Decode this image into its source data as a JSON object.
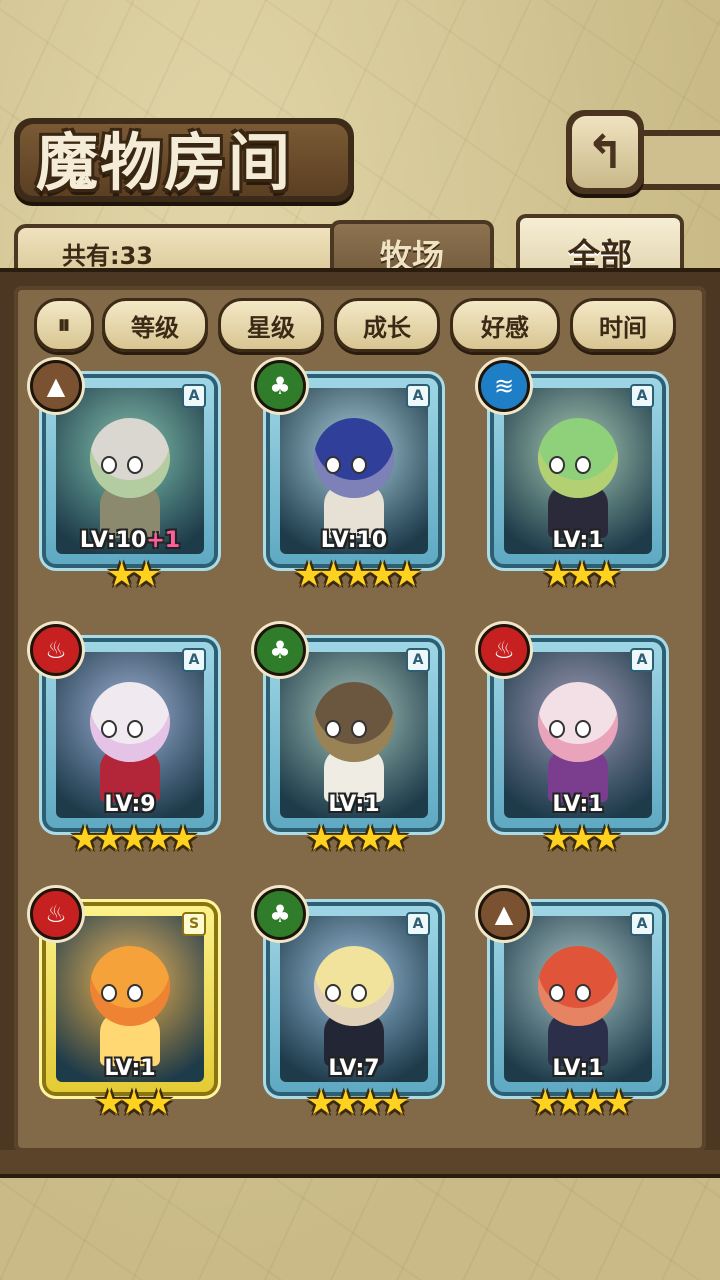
{
  "header": {
    "title": "魔物房间",
    "back_icon": "back-arrow-icon"
  },
  "count": {
    "text": "共有:33"
  },
  "tabs": [
    {
      "label": "牧场",
      "active": false
    },
    {
      "label": "全部",
      "active": true
    }
  ],
  "sort": {
    "toggle_icon": "sort-order-icon",
    "buttons": [
      "等级",
      "星级",
      "成长",
      "好感",
      "时间"
    ]
  },
  "monsters": [
    {
      "element": "earth",
      "rank": "A",
      "level": "LV:10",
      "bonus": "+1",
      "stars": 2,
      "frame": "blue",
      "colors": {
        "head": "#d9d7cf",
        "body": "#8b8a6e",
        "accent": "#7cbf5a"
      }
    },
    {
      "element": "nature",
      "rank": "A",
      "level": "LV:10",
      "bonus": "",
      "stars": 5,
      "frame": "blue",
      "colors": {
        "head": "#2f3f9a",
        "body": "#e6e1d4",
        "accent": "#f5e4e6"
      }
    },
    {
      "element": "water",
      "rank": "A",
      "level": "LV:1",
      "bonus": "",
      "stars": 3,
      "frame": "blue",
      "colors": {
        "head": "#8fd07a",
        "body": "#2b2a3a",
        "accent": "#e8d36a"
      }
    },
    {
      "element": "fire",
      "rank": "A",
      "level": "LV:9",
      "bonus": "",
      "stars": 5,
      "frame": "blue",
      "colors": {
        "head": "#f0eaf0",
        "body": "#b3263a",
        "accent": "#d28ad6"
      }
    },
    {
      "element": "nature",
      "rank": "A",
      "level": "LV:1",
      "bonus": "",
      "stars": 4,
      "frame": "blue",
      "colors": {
        "head": "#6b5740",
        "body": "#efece4",
        "accent": "#e0c27a"
      }
    },
    {
      "element": "fire",
      "rank": "A",
      "level": "LV:1",
      "bonus": "",
      "stars": 3,
      "frame": "blue",
      "colors": {
        "head": "#f3e0e6",
        "body": "#7b3e8e",
        "accent": "#d94b7a"
      }
    },
    {
      "element": "fire",
      "rank": "S",
      "level": "LV:1",
      "bonus": "",
      "stars": 3,
      "frame": "gold",
      "colors": {
        "head": "#f6a23a",
        "body": "#ffd873",
        "accent": "#e2562b"
      }
    },
    {
      "element": "nature",
      "rank": "A",
      "level": "LV:7",
      "bonus": "",
      "stars": 4,
      "frame": "blue",
      "colors": {
        "head": "#f1e39c",
        "body": "#232634",
        "accent": "#c9b8e8"
      }
    },
    {
      "element": "earth",
      "rank": "A",
      "level": "LV:1",
      "bonus": "",
      "stars": 4,
      "frame": "blue",
      "colors": {
        "head": "#e0553a",
        "body": "#2b2f4a",
        "accent": "#f0c8a0"
      }
    }
  ],
  "element_colors": {
    "earth": "#7a5232",
    "nature": "#2f7d2a",
    "water": "#1f7fc6",
    "fire": "#c62020"
  },
  "element_icons": {
    "earth": "mountain-icon",
    "nature": "leaf-icon",
    "water": "waves-icon",
    "fire": "flame-icon"
  }
}
